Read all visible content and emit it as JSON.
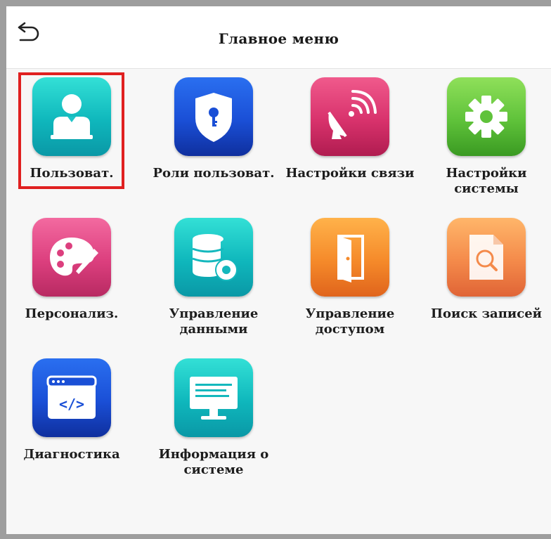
{
  "header": {
    "title": "Главное меню",
    "back_icon": "back-arrow-icon"
  },
  "selected_item": "user",
  "colors": {
    "selection_frame": "#e02020",
    "header_bg": "#ffffff",
    "content_bg": "#f7f7f7"
  },
  "menu": {
    "items": [
      {
        "id": "user",
        "icon": "user-icon",
        "label": "Пользоват."
      },
      {
        "id": "user-roles",
        "icon": "shield-key-icon",
        "label": "Роли пользоват."
      },
      {
        "id": "comm-settings",
        "icon": "satellite-dish-icon",
        "label": "Настройки связи"
      },
      {
        "id": "system-settings",
        "icon": "gear-icon",
        "label_lines": [
          "Настройки",
          "системы"
        ]
      },
      {
        "id": "personalize",
        "icon": "palette-icon",
        "label": "Персонализ."
      },
      {
        "id": "data-management",
        "icon": "database-gear-icon",
        "label_lines": [
          "Управление",
          "данными"
        ]
      },
      {
        "id": "access-control",
        "icon": "door-icon",
        "label_lines": [
          "Управление",
          "доступом"
        ]
      },
      {
        "id": "record-search",
        "icon": "document-search-icon",
        "label": "Поиск записей"
      },
      {
        "id": "diagnostics",
        "icon": "code-window-icon",
        "label": "Диагностика"
      },
      {
        "id": "system-info",
        "icon": "monitor-icon",
        "label_lines": [
          "Информация о",
          "системе"
        ]
      }
    ]
  }
}
